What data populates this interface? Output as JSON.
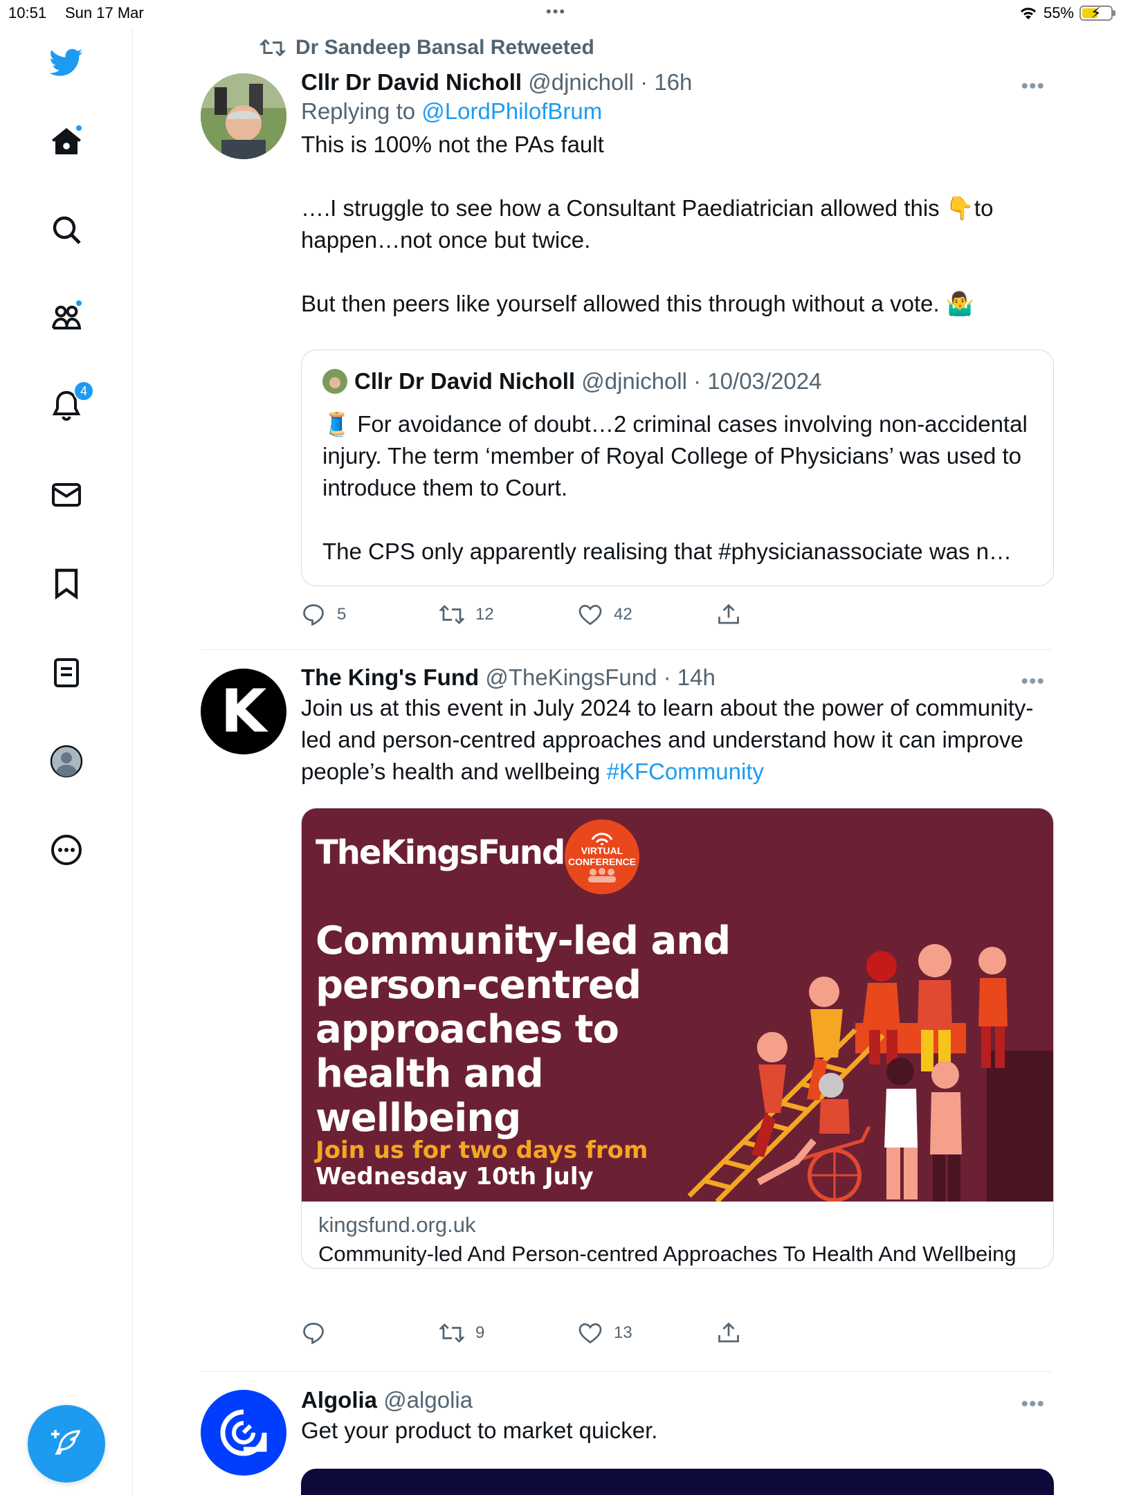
{
  "status_bar": {
    "time": "10:51",
    "date": "Sun 17 Mar",
    "battery": "55%",
    "battery_level": 0.55
  },
  "sidebar": {
    "items": [
      {
        "icon": "twitter-logo-icon"
      },
      {
        "icon": "home-icon"
      },
      {
        "icon": "search-icon"
      },
      {
        "icon": "communities-icon"
      },
      {
        "icon": "notifications-icon",
        "badge": "4"
      },
      {
        "icon": "messages-icon"
      },
      {
        "icon": "bookmarks-icon"
      },
      {
        "icon": "lists-icon"
      },
      {
        "icon": "profile-icon"
      },
      {
        "icon": "more-icon"
      }
    ],
    "compose_icon": "compose-tweet-icon"
  },
  "tweets": [
    {
      "retweeted_by": "Dr Sandeep Bansal Retweeted",
      "name": "Cllr Dr David Nicholl",
      "handle": "@djnicholl",
      "time": "· 16h",
      "replying_prefix": "Replying to ",
      "replying_to": "@LordPhilofBrum",
      "text": "This is 100% not the PAs fault\n\n….I struggle to see how a Consultant Paediatrician allowed this 👇to happen…not once but twice.\n\nBut then peers like yourself allowed this through without a vote. 🤷‍♂️",
      "quote": {
        "name": "Cllr Dr David Nicholl",
        "handle": "@djnicholl",
        "time": "· 10/03/2024",
        "text": "🧵 For avoidance of doubt…2 criminal cases involving non-accidental injury. The term ‘member of Royal College of Physicians’ was used to introduce them to Court.\n\nThe CPS only apparently realising that #physicianassociate was n…"
      },
      "replies": "5",
      "retweets": "12",
      "likes": "42"
    },
    {
      "name": "The King's Fund",
      "handle": "@TheKingsFund",
      "time": "· 14h",
      "text": "Join us at this event in July 2024 to learn about the power of community-led and person-centred approaches and understand how it can improve people’s health and wellbeing ",
      "hashtag": "#KFCommunity",
      "avatar_letter": "K",
      "card": {
        "logo": "TheKingsFund›",
        "badge_line1": "VIRTUAL",
        "badge_line2": "CONFERENCE",
        "headline": "Community-led and person-centred approaches to health and wellbeing",
        "sub1": "Join us for two days from",
        "sub2": "Wednesday 10th July",
        "domain": "kingsfund.org.uk",
        "title": "Community-led And Person-centred Approaches To Health And Wellbeing"
      },
      "replies": "",
      "retweets": "9",
      "likes": "13"
    },
    {
      "name": "Algolia",
      "handle": "@algolia",
      "time": "",
      "text": "Get your product to market quicker."
    }
  ],
  "colors": {
    "accent": "#1d9bf0",
    "card_bg": "#6c2034",
    "text": "#0f1419",
    "muted": "#536471"
  }
}
